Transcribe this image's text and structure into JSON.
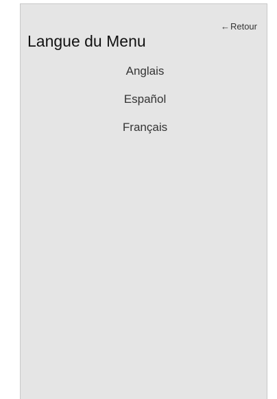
{
  "header": {
    "back_arrow": "←",
    "back_label": "Retour",
    "title": "Langue du Menu"
  },
  "languages": [
    {
      "label": "Anglais"
    },
    {
      "label": "Español"
    },
    {
      "label": "Français"
    }
  ],
  "colors": {
    "panel_background": "#e5e5e5",
    "text": "#333333",
    "title_text": "#111111"
  }
}
